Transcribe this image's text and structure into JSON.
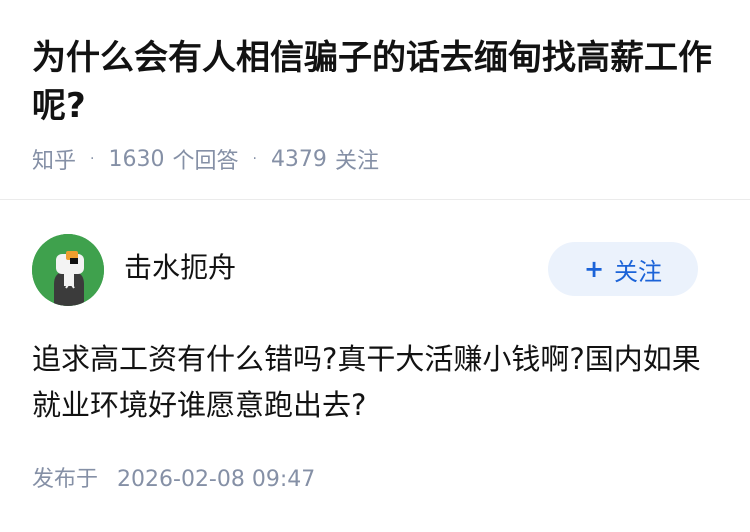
{
  "question": {
    "title": "为什么会有人相信骗子的话去缅甸找高薪工作呢?",
    "source": "知乎",
    "answer_count": "1630",
    "answer_label": "个回答",
    "follower_count": "4379",
    "follower_label": "关注"
  },
  "answer": {
    "author_name": "击水扼舟",
    "follow_label": "关注",
    "content": "追求高工资有什么错吗?真干大活赚小钱啊?国内如果就业环境好谁愿意跑出去?",
    "publish_label": "发布于",
    "publish_time": "2026-02-08 09:47"
  },
  "colors": {
    "meta_gray": "#8590a6",
    "accent_blue": "#1b63d8",
    "follow_bg": "#ebf2fc",
    "avatar_green": "#3fa14d"
  },
  "icons": {
    "follow": "plus-icon",
    "avatar": "avatar-image"
  }
}
